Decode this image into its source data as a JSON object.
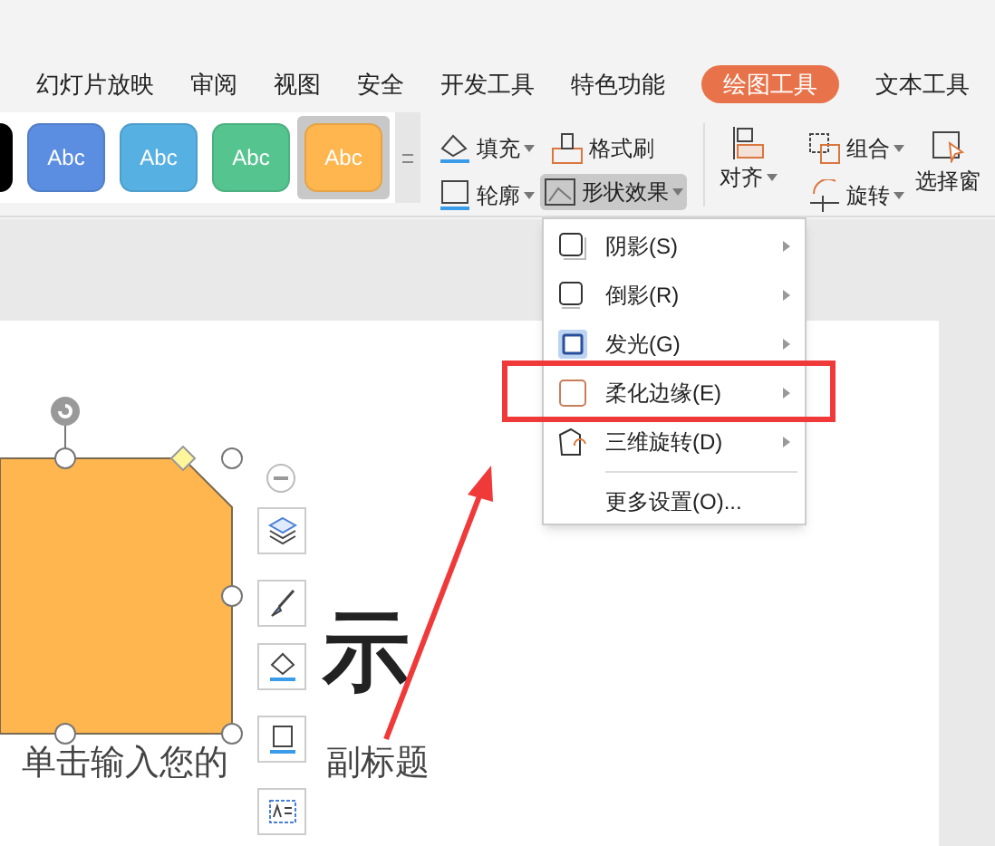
{
  "tabs": [
    {
      "label": "幻灯片放映",
      "selected": false
    },
    {
      "label": "审阅",
      "selected": false
    },
    {
      "label": "视图",
      "selected": false
    },
    {
      "label": "安全",
      "selected": false
    },
    {
      "label": "开发工具",
      "selected": false
    },
    {
      "label": "特色功能",
      "selected": false
    },
    {
      "label": "绘图工具",
      "selected": true
    },
    {
      "label": "文本工具",
      "selected": false
    }
  ],
  "style_gallery": [
    {
      "color": "#000000",
      "selected": false
    },
    {
      "label": "Abc",
      "color": "#5b8ee0",
      "selected": false
    },
    {
      "label": "Abc",
      "color": "#56b0e2",
      "selected": false
    },
    {
      "label": "Abc",
      "color": "#55c48f",
      "selected": false
    },
    {
      "label": "Abc",
      "color": "#ffb64f",
      "selected": true
    }
  ],
  "ribbon_buttons": [
    {
      "kind": "fill",
      "label": "填充",
      "dropdown": true,
      "pressed": false
    },
    {
      "kind": "outline",
      "label": "轮廓",
      "dropdown": true,
      "pressed": false
    },
    {
      "kind": "format-painter",
      "label": "格式刷",
      "dropdown": false,
      "pressed": false
    },
    {
      "kind": "effects",
      "label": "形状效果",
      "dropdown": true,
      "pressed": true
    },
    {
      "kind": "align",
      "label": "对齐",
      "dropdown": true,
      "pressed": false
    },
    {
      "kind": "group",
      "label": "组合",
      "dropdown": true,
      "pressed": false
    },
    {
      "kind": "rotate",
      "label": "旋转",
      "dropdown": true,
      "pressed": false
    },
    {
      "kind": "pane",
      "label": "选择窗",
      "dropdown": false,
      "pressed": false
    }
  ],
  "effects_menu": [
    {
      "kind": "shadow",
      "label": "阴影(S)",
      "submenu": true
    },
    {
      "kind": "reflection",
      "label": "倒影(R)",
      "submenu": true
    },
    {
      "kind": "glow",
      "label": "发光(G)",
      "submenu": true
    },
    {
      "kind": "soft-edge",
      "label": "柔化边缘(E)",
      "submenu": true
    },
    {
      "kind": "rotate3d",
      "label": "三维旋转(D)",
      "submenu": true
    },
    {
      "kind": "more",
      "label": "更多设置(O)...",
      "submenu": false
    }
  ],
  "slide": {
    "title": "示",
    "subtitle_parts": [
      "单击输入您的",
      "副标题"
    ]
  }
}
